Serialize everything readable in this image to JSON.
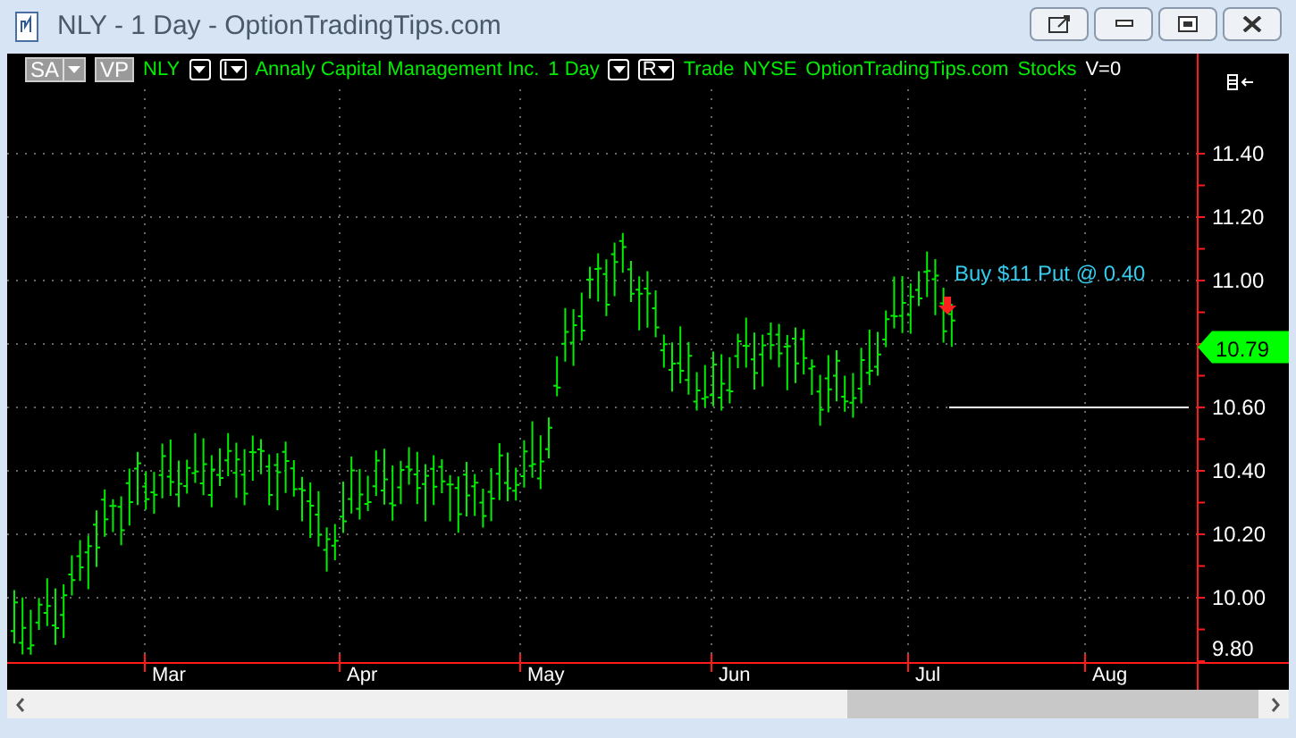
{
  "window": {
    "title": "NLY - 1 Day - OptionTradingTips.com"
  },
  "toolbar": [
    {
      "kind": "menu-button",
      "label": "SA"
    },
    {
      "kind": "button",
      "label": "VP"
    },
    {
      "kind": "text",
      "label": "NLY"
    },
    {
      "kind": "dropdown"
    },
    {
      "kind": "letter-dropdown",
      "label": "I"
    },
    {
      "kind": "text",
      "label": "Annaly Capital Management Inc."
    },
    {
      "kind": "text",
      "label": "1 Day"
    },
    {
      "kind": "dropdown"
    },
    {
      "kind": "letter-dropdown",
      "label": "R"
    },
    {
      "kind": "text",
      "label": "Trade"
    },
    {
      "kind": "text",
      "label": "NYSE"
    },
    {
      "kind": "text",
      "label": "OptionTradingTips.com"
    },
    {
      "kind": "text",
      "label": "Stocks"
    },
    {
      "kind": "value",
      "label": "V=0"
    }
  ],
  "chart": {
    "annotation": "Buy $11 Put @ 0.40",
    "last_price": "10.79",
    "price_labels": [
      "11.40",
      "11.20",
      "11.00",
      "10.60",
      "10.40",
      "10.20",
      "10.00",
      "9.80"
    ],
    "month_labels": [
      "Mar",
      "Apr",
      "May",
      "Jun",
      "Jul",
      "Aug"
    ]
  }
}
